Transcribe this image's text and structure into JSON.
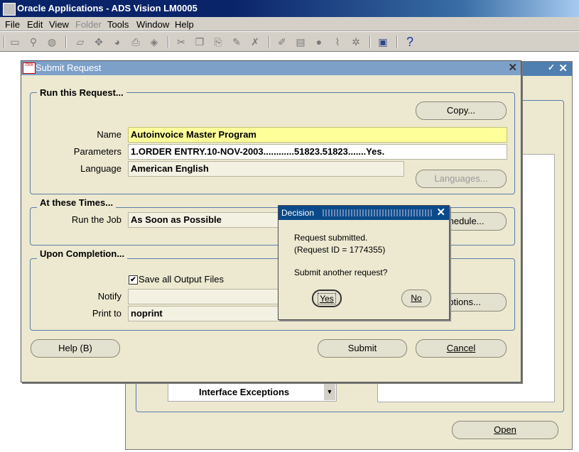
{
  "app": {
    "title": "Oracle Applications - ADS Vision LM0005"
  },
  "menu": [
    {
      "label": "File",
      "enabled": true
    },
    {
      "label": "Edit",
      "enabled": true
    },
    {
      "label": "View",
      "enabled": true
    },
    {
      "label": "Folder",
      "enabled": false
    },
    {
      "label": "Tools",
      "enabled": true
    },
    {
      "label": "Window",
      "enabled": true
    },
    {
      "label": "Help",
      "enabled": true
    }
  ],
  "toolbar_icons": [
    "new-icon",
    "find-icon",
    "navigator-icon",
    "save-icon",
    "next-step-icon",
    "switch-responsibility-icon",
    "print-icon",
    "close-form-icon",
    "cut-icon",
    "copy-icon",
    "paste-icon",
    "new-record-icon",
    "delete-record-icon",
    "edit-field-icon",
    "zoom-icon",
    "translations-icon",
    "attachments-icon",
    "folder-tools-icon",
    "window-help-icon"
  ],
  "toolbar_help": "?",
  "submit_request": {
    "title": "Submit Request",
    "run_group_title": "Run this Request...",
    "copy_button": "Copy...",
    "name_label": "Name",
    "name_value": "Autoinvoice Master Program",
    "parameters_label": "Parameters",
    "parameters_value": "1.ORDER ENTRY.10-NOV-2003............51823.51823.......Yes.",
    "language_label": "Language",
    "language_value": "American English",
    "languages_button": "Languages...",
    "times_group_title": "At these Times...",
    "run_job_label": "Run the Job",
    "run_job_value": "As Soon as Possible",
    "schedule_button": "Schedule...",
    "completion_group_title": "Upon Completion...",
    "save_output_label": "Save all Output Files",
    "save_output_checked": true,
    "notify_label": "Notify",
    "notify_value": "",
    "print_to_label": "Print to",
    "print_to_value": "noprint",
    "options_button": "Options...",
    "help_button": "Help (B)",
    "submit_button": "Submit",
    "cancel_button": "Cancel"
  },
  "background_window": {
    "list_value": "Interface Exceptions",
    "open_button": "Open"
  },
  "decision": {
    "title": "Decision",
    "line1": "Request submitted.",
    "line2": "(Request ID = 1774355)",
    "question": "Submit another request?",
    "yes_button": "Yes",
    "no_button": "No"
  }
}
